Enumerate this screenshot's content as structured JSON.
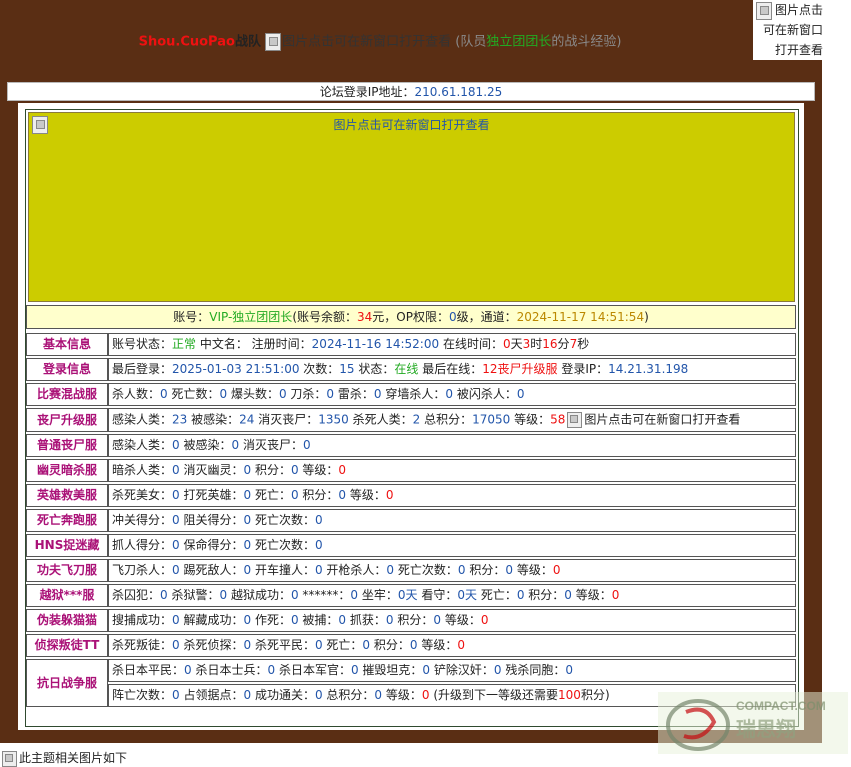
{
  "header": {
    "team_prefix": "Shou.CuoPao",
    "team_word": "战队",
    "image_alt": "图片点击可在新窗口打开查看",
    "member_open": "(队员",
    "member_name": "独立团团长",
    "member_close": "的战斗经验)",
    "corner_alt": "图片点击可在新窗口打开查看"
  },
  "ip_bar": {
    "label": "论坛登录IP地址：",
    "value": "210.61.181.25"
  },
  "banner": {
    "alt": "图片点击可在新窗口打开查看",
    "bg_color": "#cccc00"
  },
  "account": {
    "label": "账号：",
    "name": "VIP-独立团团长",
    "balance_label": "(账号余额：",
    "balance": "34",
    "balance_unit": "元，OP权限：",
    "op_level": "0",
    "op_unit": "级，通道：",
    "channel_time": "2024-11-17 14:51:54",
    "close": ")"
  },
  "rows": {
    "basic": {
      "label": "基本信息",
      "status_label": "账号状态：",
      "status": "正常",
      "cn_name_label": " 中文名： 注册时间：",
      "reg_time": "2024-11-16 14:52:00",
      "online_label": " 在线时间：",
      "days": "0",
      "d": "天",
      "hours": "3",
      "h": "时",
      "mins": "16",
      "m": "分",
      "secs": "7",
      "s": "秒"
    },
    "login": {
      "label": "登录信息",
      "last_login_label": "最后登录：",
      "last_login": "2025-01-03 21:51:00",
      "count_label": " 次数：",
      "count": "15",
      "state_label": " 状态：",
      "state": "在线",
      "last_online_label": " 最后在线：",
      "last_online": "12丧尸升级服",
      "ip_label": " 登录IP：",
      "ip": "14.21.31.198"
    },
    "melee": {
      "label": "比赛混战服",
      "text": [
        "杀人数：",
        "0",
        " 死亡数：",
        "0",
        " 爆头数：",
        "0",
        " 刀杀：",
        "0",
        " 雷杀：",
        "0",
        " 穿墙杀人：",
        "0",
        " 被闪杀人：",
        "0"
      ]
    },
    "zombie_up": {
      "label": "丧尸升级服",
      "text": [
        "感染人类：",
        "23",
        " 被感染：",
        "24",
        " 消灭丧尸：",
        "1350",
        " 杀死人类：",
        "2",
        " 总积分：",
        "17050",
        " 等级：",
        "58"
      ],
      "img_alt": "图片点击可在新窗口打开查看"
    },
    "zombie": {
      "label": "普通丧尸服",
      "text": [
        "感染人类：",
        "0",
        " 被感染：",
        "0",
        " 消灭丧尸：",
        "0"
      ]
    },
    "ghost": {
      "label": "幽灵暗杀服",
      "text": [
        "暗杀人类：",
        "0",
        " 消灭幽灵：",
        "0",
        " 积分：",
        "0",
        " 等级：",
        "0"
      ]
    },
    "hero": {
      "label": "英雄救美服",
      "text": [
        "杀死美女：",
        "0",
        " 打死英雄：",
        "0",
        " 死亡：",
        "0",
        " 积分：",
        "0",
        " 等级：",
        "0"
      ]
    },
    "death_run": {
      "label": "死亡奔跑服",
      "text": [
        "冲关得分：",
        "0",
        " 阻关得分：",
        "0",
        " 死亡次数：",
        "0"
      ]
    },
    "hns": {
      "label": "HNS捉迷藏",
      "text": [
        "抓人得分：",
        "0",
        " 保命得分：",
        "0",
        " 死亡次数：",
        "0"
      ]
    },
    "kungfu": {
      "label": "功夫飞刀服",
      "text": [
        "飞刀杀人：",
        "0",
        " 踢死敌人：",
        "0",
        " 开车撞人：",
        "0",
        " 开枪杀人：",
        "0",
        " 死亡次数：",
        "0",
        " 积分：",
        "0",
        " 等级：",
        "0"
      ]
    },
    "jail": {
      "label": "越狱***服",
      "text": [
        "杀囚犯：",
        "0",
        " 杀狱警：",
        "0",
        " 越狱成功：",
        "0",
        " ******：",
        "0",
        " 坐牢：",
        "0天",
        " 看守：",
        "0天",
        " 死亡：",
        "0",
        " 积分：",
        "0",
        " 等级：",
        "0"
      ]
    },
    "disguise": {
      "label": "伪装躲猫猫",
      "text": [
        "搜捕成功：",
        "0",
        " 解藏成功：",
        "0",
        " 作死：",
        "0",
        " 被捕：",
        "0",
        " 抓获：",
        "0",
        " 积分：",
        "0",
        " 等级：",
        "0"
      ]
    },
    "detective": {
      "label": "侦探叛徒TT",
      "text": [
        "杀死叛徒：",
        "0",
        " 杀死侦探：",
        "0",
        " 杀死平民：",
        "0",
        " 死亡：",
        "0",
        " 积分：",
        "0",
        " 等级：",
        "0"
      ]
    },
    "war": {
      "label": "抗日战争服",
      "line1": [
        "杀日本平民：",
        "0",
        " 杀日本士兵：",
        "0",
        " 杀日本军官：",
        "0",
        " 摧毁坦克：",
        "0",
        " 铲除汉奸：",
        "0",
        " 残杀同胞：",
        "0"
      ],
      "line2": [
        "阵亡次数：",
        "0",
        " 占领据点：",
        "0",
        " 成功通关：",
        "0",
        " 总积分：",
        "0",
        " 等级：",
        "0",
        " (升级到下一等级还需要",
        "100",
        "积分)"
      ]
    }
  },
  "footer": {
    "text": "此主题相关图片如下"
  },
  "watermark": {
    "text1": "COMPACT.COM",
    "text2": "瑞思翔"
  }
}
